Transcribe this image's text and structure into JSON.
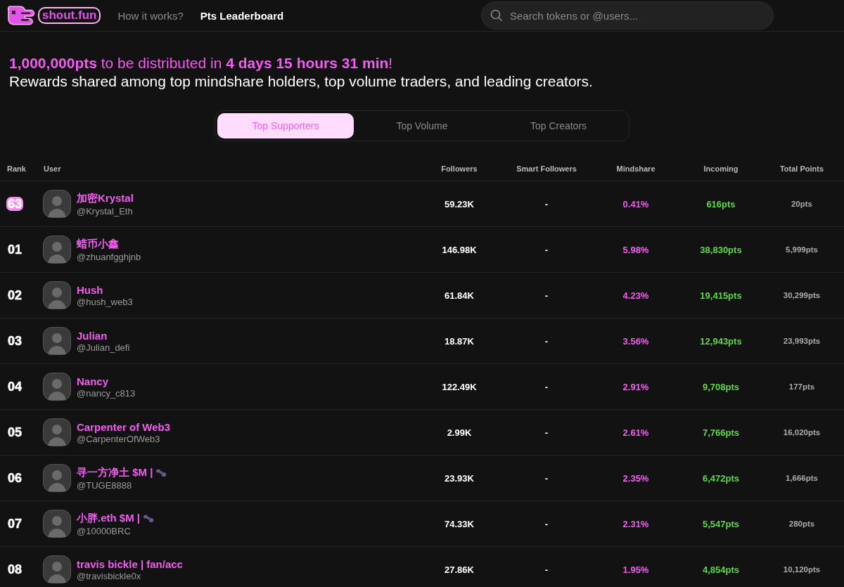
{
  "header": {
    "logo_text": "shout.fun",
    "nav": [
      {
        "label": "How it works?",
        "selected": false
      },
      {
        "label": "Pts Leaderboard",
        "selected": true
      }
    ],
    "search": {
      "placeholder": "Search tokens or @users..."
    }
  },
  "banner": {
    "headline": "**1,000,000pts** to be distributed in **4 days 15 hours 31 min**!",
    "subline": "Rewards shared among top mindshare holders, top volume traders, and leading creators."
  },
  "tabs": [
    {
      "label": "Top Supporters",
      "selected": true
    },
    {
      "label": "Top Volume",
      "selected": false
    },
    {
      "label": "Top Creators",
      "selected": false
    }
  ],
  "table": {
    "columns": [
      "Rank",
      "User",
      "Followers",
      "Smart Followers",
      "Mindshare",
      "Incoming",
      "Total Points"
    ],
    "rows": [
      {
        "rank": "63",
        "highlighted": true,
        "name": "加密Krystal",
        "handle": "@Krystal_Eth",
        "ant_badge": false,
        "followers": "59.23K",
        "smart_followers": "-",
        "mindshare": "0.41%",
        "incoming": "616pts",
        "total_points": "20pts"
      },
      {
        "rank": "01",
        "highlighted": false,
        "name": "蜡币小鑫",
        "handle": "@zhuanfgghjnb",
        "ant_badge": false,
        "followers": "146.98K",
        "smart_followers": "-",
        "mindshare": "5.98%",
        "incoming": "38,830pts",
        "total_points": "5,999pts"
      },
      {
        "rank": "02",
        "highlighted": false,
        "name": "Hush",
        "handle": "@hush_web3",
        "ant_badge": false,
        "followers": "61.84K",
        "smart_followers": "-",
        "mindshare": "4.23%",
        "incoming": "19,415pts",
        "total_points": "30,299pts"
      },
      {
        "rank": "03",
        "highlighted": false,
        "name": "Julian",
        "handle": "@Julian_defi",
        "ant_badge": false,
        "followers": "18.87K",
        "smart_followers": "-",
        "mindshare": "3.56%",
        "incoming": "12,943pts",
        "total_points": "23,993pts"
      },
      {
        "rank": "04",
        "highlighted": false,
        "name": "Nancy",
        "handle": "@nancy_c813",
        "ant_badge": false,
        "followers": "122.49K",
        "smart_followers": "-",
        "mindshare": "2.91%",
        "incoming": "9,708pts",
        "total_points": "177pts"
      },
      {
        "rank": "05",
        "highlighted": false,
        "name": "Carpenter of Web3",
        "handle": "@CarpenterOfWeb3",
        "ant_badge": false,
        "followers": "2.99K",
        "smart_followers": "-",
        "mindshare": "2.61%",
        "incoming": "7,766pts",
        "total_points": "16,020pts"
      },
      {
        "rank": "06",
        "highlighted": false,
        "name": "寻一方净土 $M |",
        "handle": "@TUGE8888",
        "ant_badge": true,
        "followers": "23.93K",
        "smart_followers": "-",
        "mindshare": "2.35%",
        "incoming": "6,472pts",
        "total_points": "1,666pts"
      },
      {
        "rank": "07",
        "highlighted": false,
        "name": "小胖.eth $M |",
        "handle": "@10000BRC",
        "ant_badge": true,
        "followers": "74.33K",
        "smart_followers": "-",
        "mindshare": "2.31%",
        "incoming": "5,547pts",
        "total_points": "280pts"
      },
      {
        "rank": "08",
        "highlighted": false,
        "name": "travis bickle | fan/acc",
        "handle": "@travisbickle0x",
        "ant_badge": false,
        "followers": "27.86K",
        "smart_followers": "-",
        "mindshare": "1.95%",
        "incoming": "4,854pts",
        "total_points": "10,120pts"
      }
    ]
  }
}
